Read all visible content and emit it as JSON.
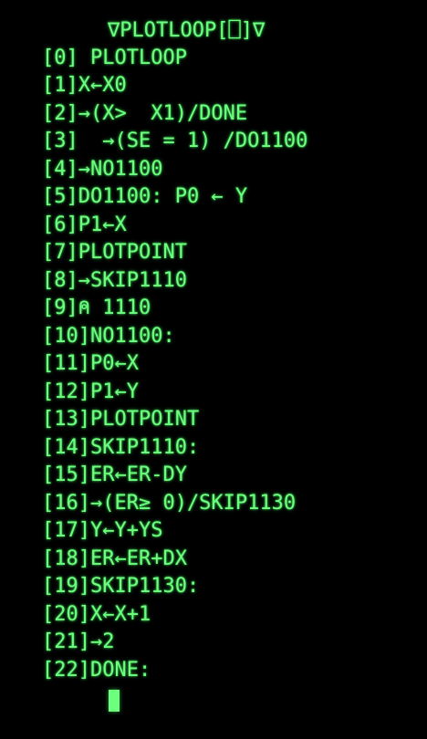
{
  "terminal": {
    "title": "∇PLOTLOOP[⎕]∇",
    "lines": [
      "[0] PLOTLOOP",
      "[1]X←X0",
      "[2]→(X>  X1)/DONE",
      "[3]  →(SE = 1) /DO1100",
      "[4]→NO1100",
      "[5]DO1100: P0 ← Y",
      "[6]P1←X",
      "[7]PLOTPOINT",
      "[8]→SKIP1110",
      "[9]⍝ 1110",
      "[10]NO1100:",
      "[11]P0←X",
      "[12]P1←Y",
      "[13]PLOTPOINT",
      "[14]SKIP1110:",
      "[15]ER←ER-DY",
      "[16]→(ER≥ 0)/SKIP1130",
      "[17]Y←Y+YS",
      "[18]ER←ER+DX",
      "[19]SKIP1130:",
      "[20]X←X+1",
      "[21]→2",
      "[22]DONE:"
    ]
  },
  "colors": {
    "background": "#000000",
    "phosphor_green": "#6dff7e"
  }
}
